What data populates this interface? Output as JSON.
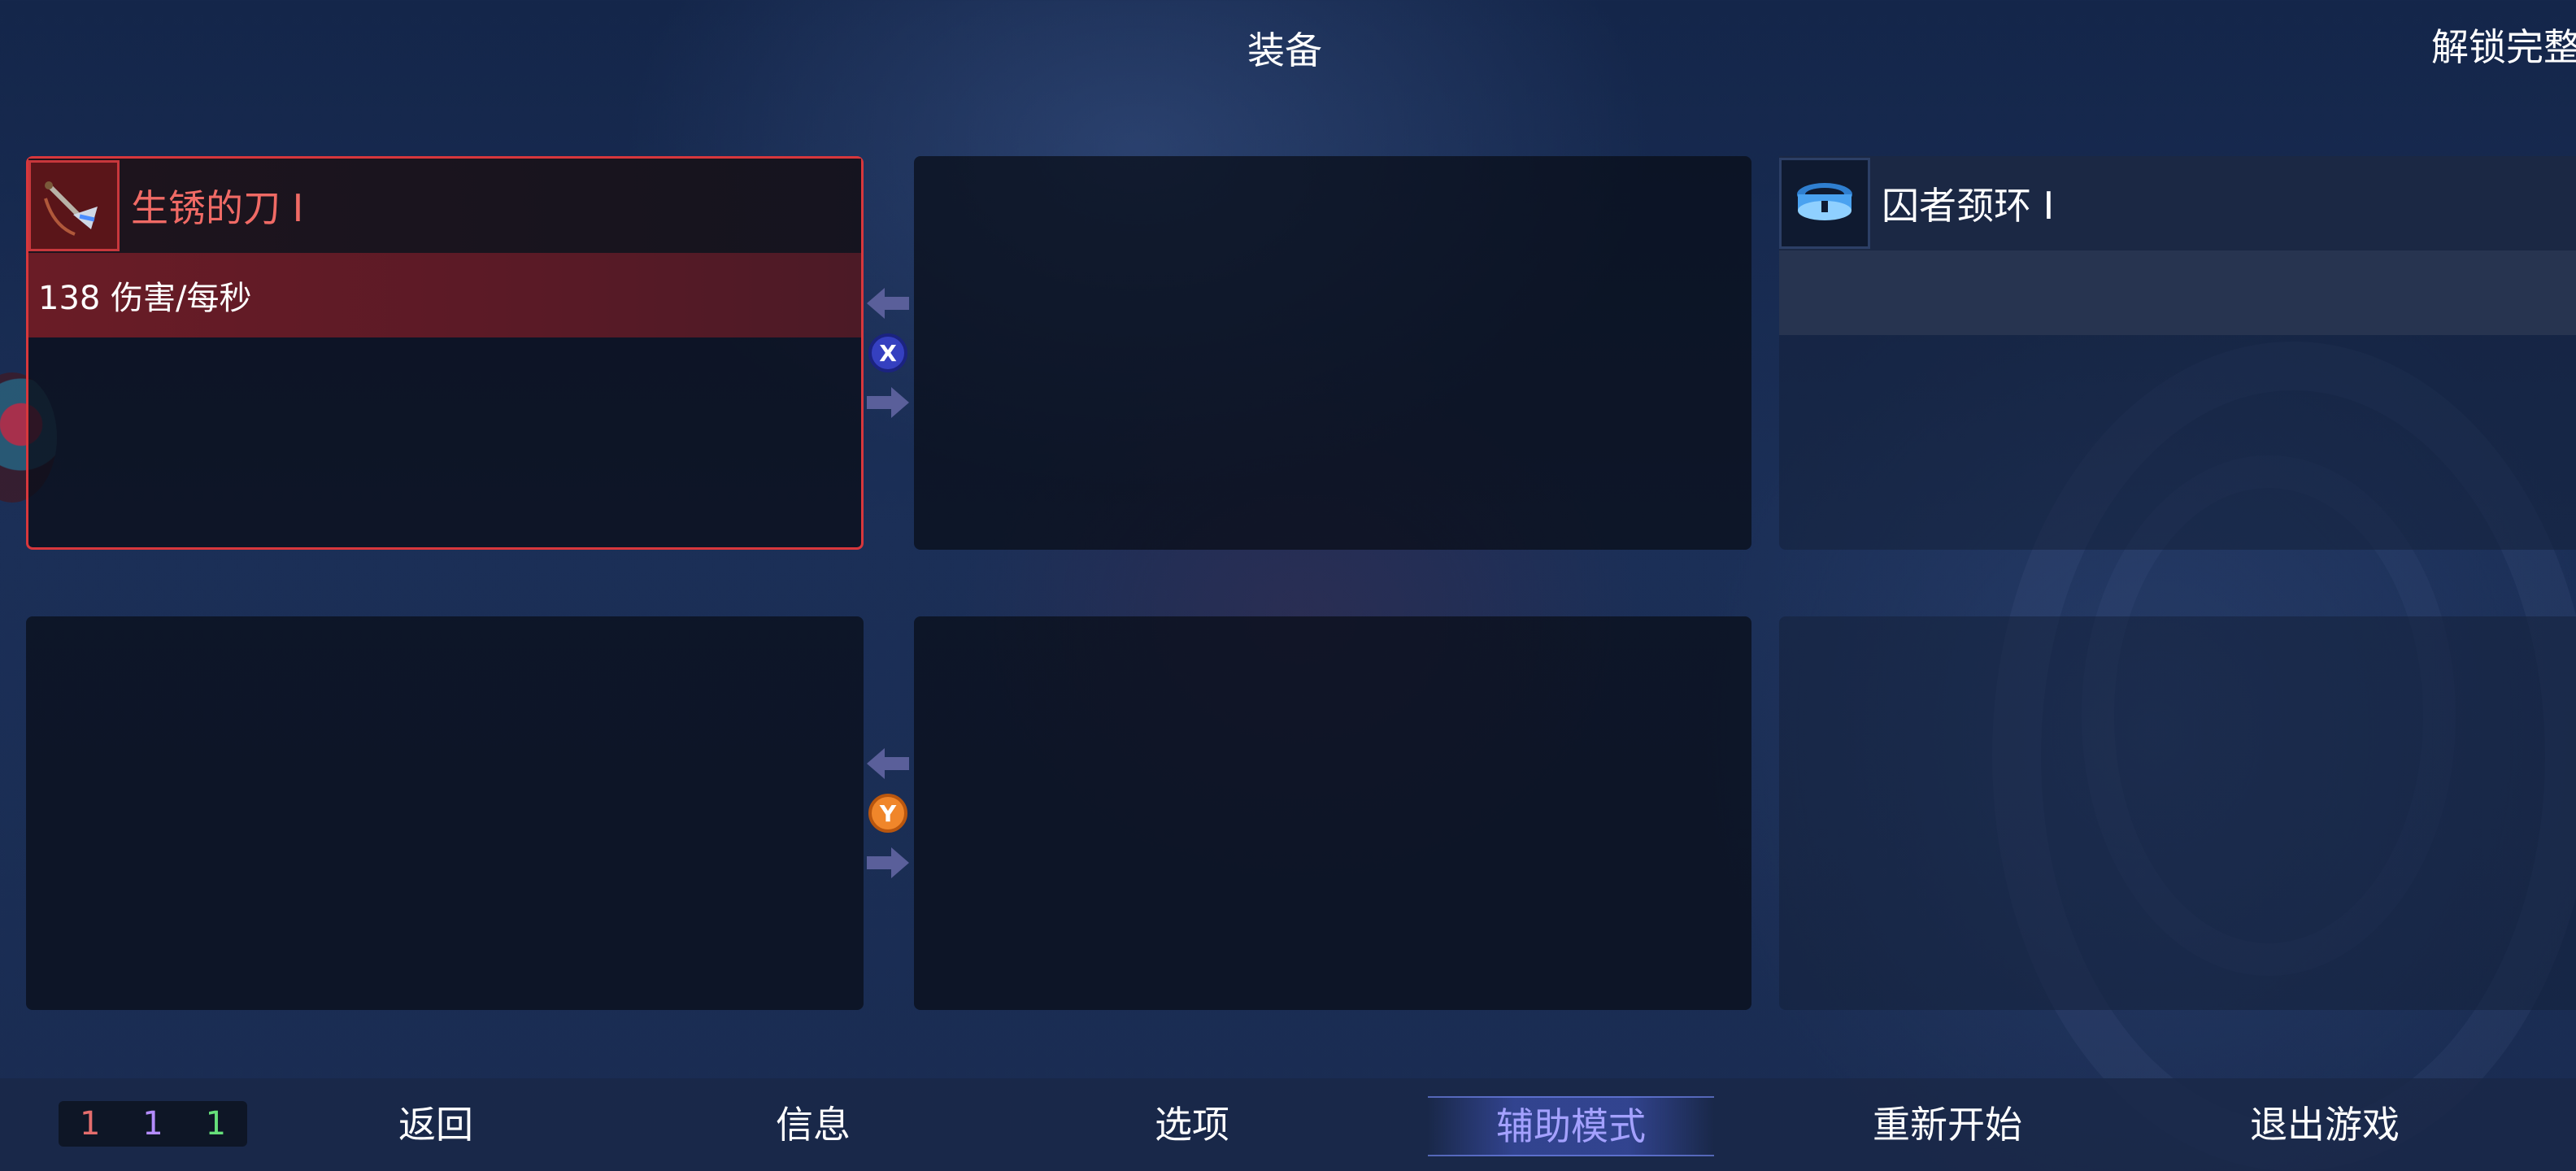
{
  "title": "装备",
  "top_right_text": "解锁完整",
  "top_left_faded_text": "",
  "slots": {
    "weapon_primary": {
      "name": "生锈的刀 Ⅰ",
      "stat": "138 伤害/每秒",
      "icon": "rusty-blade-icon",
      "accent": "#d8373c"
    },
    "amulet": {
      "name": "囚者颈环 Ⅰ",
      "icon": "collar-amulet-icon"
    }
  },
  "swap_buttons": {
    "top": {
      "key": "X",
      "color": "#3540c0"
    },
    "bottom": {
      "key": "Y",
      "color": "#f0862a"
    }
  },
  "counters": {
    "red": "1",
    "purple": "1",
    "green": "1"
  },
  "menu": {
    "back": "返回",
    "info": "信息",
    "options": "选项",
    "assist": "辅助模式",
    "restart": "重新开始",
    "quit": "退出游戏"
  },
  "colors": {
    "counter_red": "#e46d6d",
    "counter_purple": "#b48cff",
    "counter_green": "#66e07a",
    "active_menu": "#a4a1ff"
  }
}
